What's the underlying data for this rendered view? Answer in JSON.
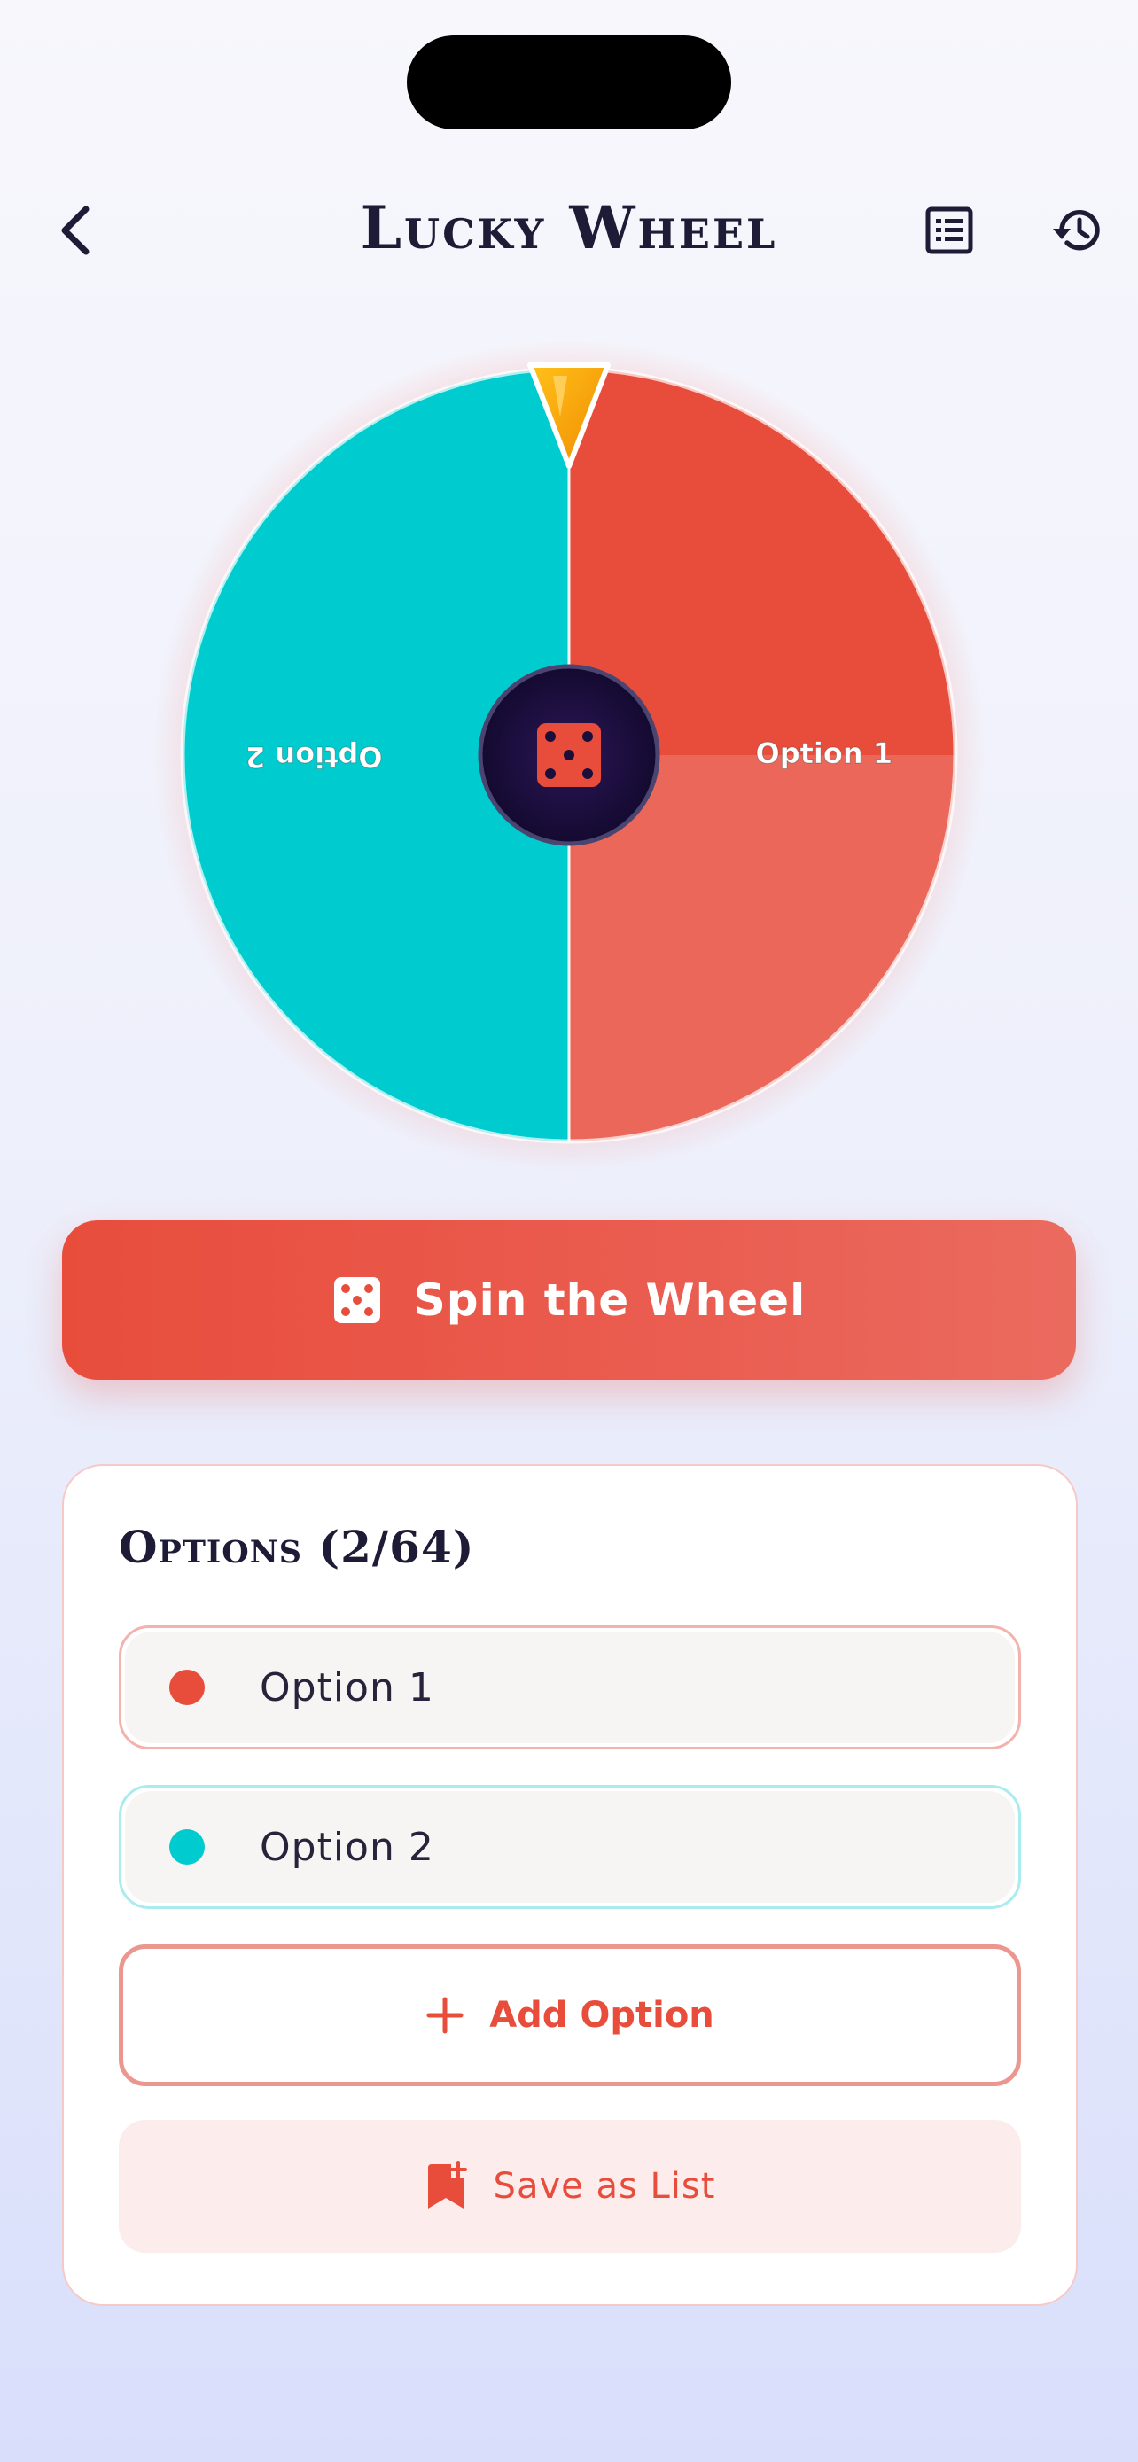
{
  "header": {
    "title": "Lucky Wheel"
  },
  "wheel": {
    "options": [
      {
        "label": "Option 1",
        "color": "#e84d3c"
      },
      {
        "label": "Option 2",
        "color": "#00cccf"
      }
    ],
    "pointer_color": "#f5a800",
    "hub_color": "#1a0f3a"
  },
  "spin_button": {
    "label": "Spin the Wheel"
  },
  "options_panel": {
    "title": "Options (2/64)",
    "items": [
      {
        "label": "Option 1",
        "color": "#e84d3c",
        "border": "#f3b3ad"
      },
      {
        "label": "Option 2",
        "color": "#00cccf",
        "border": "#a8ecee"
      }
    ],
    "add_label": "Add Option",
    "save_label": "Save as List"
  },
  "icons": {
    "back": "chevron-left-icon",
    "list": "list-icon",
    "history": "history-icon",
    "dice": "dice-icon",
    "plus": "plus-icon",
    "save": "bookmark-plus-icon"
  }
}
